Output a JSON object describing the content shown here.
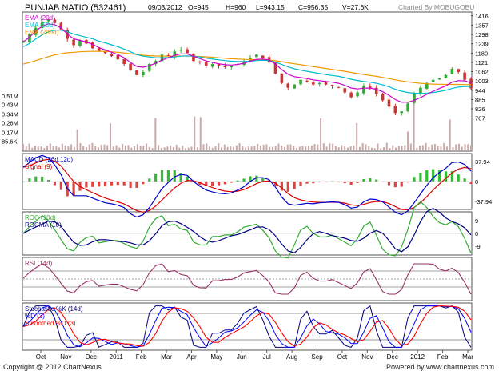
{
  "header": {
    "name": "PUNJAB NATIO (532461)",
    "date": "09/03/2012",
    "open": "O=945",
    "high": "H=960",
    "low": "L=943.15",
    "close": "C=956.35",
    "volume": "V=27.6K",
    "charted_by": "Charted By MOBUGOBU"
  },
  "footer": {
    "copyright": "Copyright @ 2012 ChartNexus",
    "powered_by": "Powered by www.chartnexus.com"
  },
  "colors": {
    "background": "#ffffff",
    "border": "#555555",
    "ema20": "#cc00cc",
    "ema50": "#00bbcc",
    "ema200": "#ee9900",
    "candle_up": "#33aa33",
    "candle_down": "#cc3333",
    "volume": "#c9a9a9",
    "macd": "#0000cc",
    "signal": "#dd0000",
    "hist_pos": "#33bb33",
    "hist_neg": "#dd4444",
    "roc": "#33aa33",
    "rocma": "#000080",
    "rsi": "#993366",
    "stoch_k": "#000080",
    "stoch_d": "#0000ff",
    "stoch_sd": "#ff0000"
  },
  "chart_data": [
    {
      "type": "candlestick",
      "panel": "price",
      "legend": [
        "EMA (20d)",
        "EMA (50d)",
        "EMA (200d)"
      ],
      "y_ticks": [
        "1416",
        "1357",
        "1298",
        "1239",
        "1180",
        "1121",
        "1062",
        "1003",
        "944",
        "885",
        "826",
        "767"
      ],
      "ylim": [
        740,
        1430
      ],
      "x_labels": [
        "Oct",
        "Nov",
        "Dec",
        "2011",
        "Feb",
        "Mar",
        "Apr",
        "May",
        "Jun",
        "Jul",
        "Aug",
        "Sep",
        "Oct",
        "Nov",
        "Dec",
        "2012",
        "Feb",
        "Mar"
      ],
      "close_series": [
        1250,
        1300,
        1340,
        1380,
        1395,
        1370,
        1330,
        1270,
        1230,
        1260,
        1240,
        1210,
        1190,
        1180,
        1160,
        1140,
        1110,
        1070,
        1040,
        1060,
        1110,
        1130,
        1170,
        1160,
        1190,
        1200,
        1180,
        1130,
        1120,
        1100,
        1110,
        1100,
        1090,
        1100,
        1110,
        1130,
        1150,
        1170,
        1150,
        1120,
        1050,
        990,
        960,
        980,
        1010,
        1000,
        980,
        990,
        980,
        970,
        960,
        930,
        900,
        930,
        970,
        960,
        920,
        880,
        840,
        800,
        810,
        860,
        920,
        960,
        990,
        1010,
        1020,
        1040,
        1080,
        1060,
        1010,
        956
      ],
      "ema20": [
        1250,
        1280,
        1320,
        1350,
        1365,
        1360,
        1340,
        1300,
        1270,
        1260,
        1250,
        1235,
        1215,
        1200,
        1185,
        1170,
        1150,
        1120,
        1095,
        1090,
        1100,
        1115,
        1135,
        1150,
        1165,
        1175,
        1175,
        1160,
        1145,
        1130,
        1120,
        1112,
        1106,
        1104,
        1108,
        1115,
        1128,
        1140,
        1142,
        1136,
        1110,
        1075,
        1045,
        1030,
        1024,
        1018,
        1010,
        1005,
        1000,
        995,
        988,
        975,
        958,
        952,
        957,
        958,
        950,
        935,
        912,
        885,
        868,
        868,
        880,
        898,
        918,
        938,
        955,
        972,
        995,
        1005,
        1004,
        990
      ],
      "ema50": [
        1220,
        1240,
        1270,
        1295,
        1315,
        1325,
        1325,
        1315,
        1300,
        1290,
        1280,
        1270,
        1255,
        1245,
        1232,
        1220,
        1205,
        1188,
        1170,
        1160,
        1155,
        1150,
        1150,
        1152,
        1155,
        1160,
        1162,
        1160,
        1155,
        1148,
        1142,
        1137,
        1132,
        1128,
        1126,
        1126,
        1128,
        1132,
        1134,
        1132,
        1122,
        1108,
        1092,
        1080,
        1072,
        1064,
        1057,
        1050,
        1044,
        1038,
        1032,
        1024,
        1014,
        1006,
        1000,
        995,
        988,
        978,
        966,
        950,
        938,
        930,
        925,
        924,
        926,
        930,
        936,
        944,
        955,
        964,
        968,
        968
      ],
      "ema200": [
        1110,
        1120,
        1132,
        1145,
        1157,
        1168,
        1176,
        1182,
        1185,
        1188,
        1190,
        1191,
        1191,
        1190,
        1188,
        1185,
        1181,
        1176,
        1170,
        1166,
        1163,
        1161,
        1160,
        1160,
        1160,
        1161,
        1161,
        1160,
        1158,
        1156,
        1153,
        1150,
        1147,
        1144,
        1142,
        1140,
        1139,
        1138,
        1137,
        1135,
        1131,
        1125,
        1118,
        1112,
        1106,
        1100,
        1094,
        1088,
        1082,
        1076,
        1070,
        1064,
        1057,
        1050,
        1044,
        1038,
        1032,
        1025,
        1018,
        1010,
        1003,
        997,
        992,
        988,
        985,
        983,
        982,
        981,
        981,
        981,
        980,
        979
      ]
    },
    {
      "type": "bar",
      "panel": "volume",
      "y_ticks": [
        "0.51M",
        "0.43M",
        "0.34M",
        "0.26M",
        "0.17M",
        "85.6K"
      ],
      "ylim": [
        0,
        0.6
      ]
    },
    {
      "type": "line",
      "panel": "macd",
      "legend": [
        "MACD (26d,12d)",
        "Signal (9)"
      ],
      "y_ticks": [
        "37.94",
        "0",
        "-37.94"
      ],
      "ylim": [
        -50,
        50
      ]
    },
    {
      "type": "line",
      "panel": "roc",
      "legend": [
        "ROC (10d)",
        "ROCMA (10)"
      ],
      "y_ticks": [
        "9",
        "0",
        "-9"
      ],
      "ylim": [
        -14,
        14
      ]
    },
    {
      "type": "line",
      "panel": "rsi",
      "legend": [
        "RSI (14d)"
      ],
      "ylim": [
        0,
        100
      ]
    },
    {
      "type": "line",
      "panel": "stochastic",
      "legend": [
        "Stochastic %K (14d)",
        "%D (3)",
        "Smoothed %D (3)"
      ],
      "ylim": [
        0,
        100
      ]
    }
  ]
}
